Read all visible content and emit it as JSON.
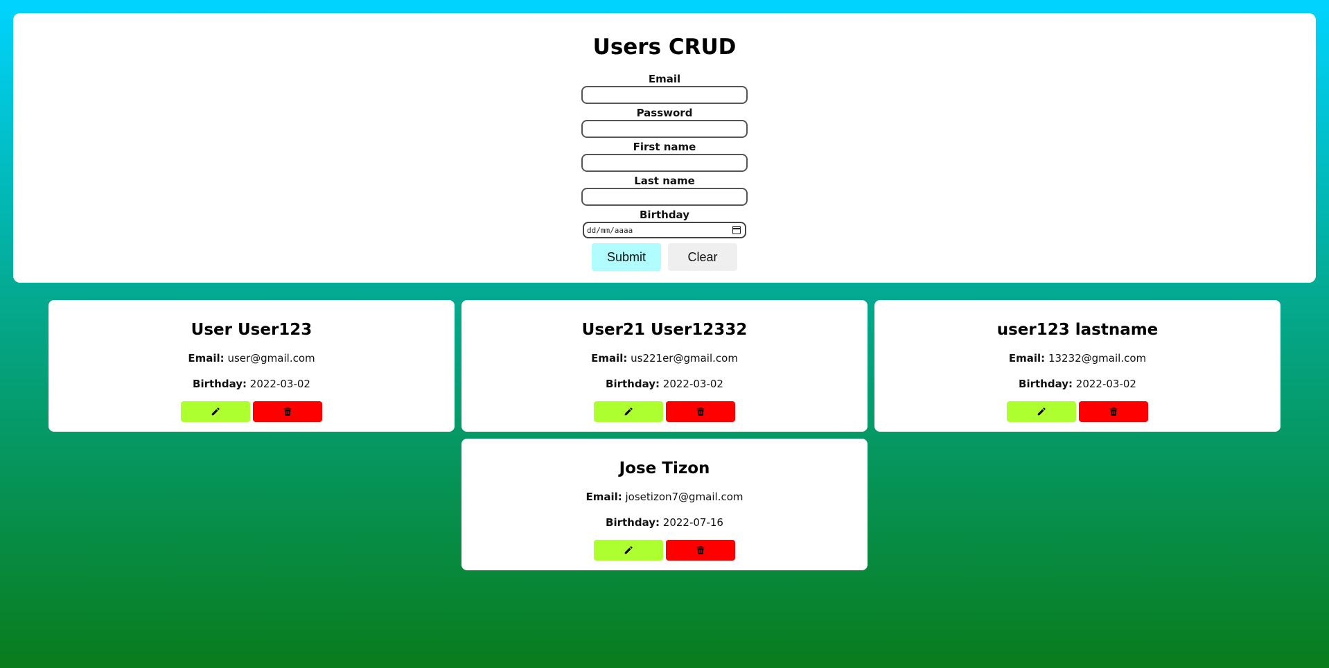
{
  "form": {
    "title": "Users CRUD",
    "fields": {
      "email": {
        "label": "Email",
        "value": ""
      },
      "password": {
        "label": "Password",
        "value": ""
      },
      "first_name": {
        "label": "First name",
        "value": ""
      },
      "last_name": {
        "label": "Last name",
        "value": ""
      },
      "birthday": {
        "label": "Birthday",
        "placeholder": "dd/mm/aaaa"
      }
    },
    "submit_label": "Submit",
    "clear_label": "Clear"
  },
  "users": [
    {
      "name": "User User123",
      "email_label": "Email:",
      "email": "user@gmail.com",
      "birthday_label": "Birthday:",
      "birthday": "2022-03-02"
    },
    {
      "name": "User21 User12332",
      "email_label": "Email:",
      "email": "us221er@gmail.com",
      "birthday_label": "Birthday:",
      "birthday": "2022-03-02"
    },
    {
      "name": "user123 lastname",
      "email_label": "Email:",
      "email": "13232@gmail.com",
      "birthday_label": "Birthday:",
      "birthday": "2022-03-02"
    },
    {
      "name": "Jose Tizon",
      "email_label": "Email:",
      "email": "josetizon7@gmail.com",
      "birthday_label": "Birthday:",
      "birthday": "2022-07-16"
    }
  ],
  "icons": {
    "edit": "pencil-icon",
    "delete": "trash-icon"
  },
  "colors": {
    "submit": "#b0fcff",
    "edit": "#adff2f",
    "delete": "#ff0000"
  }
}
